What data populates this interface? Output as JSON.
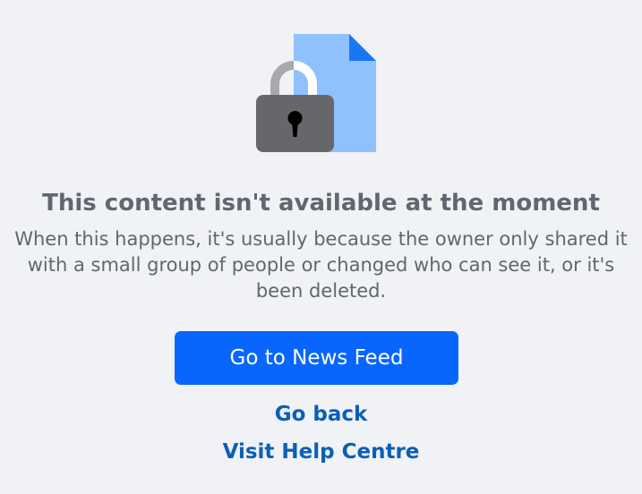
{
  "message": {
    "title": "This content isn't available at the moment",
    "description": "When this happens, it's usually because the owner only shared it with a small group of people or changed who can see it, or it's been deleted."
  },
  "actions": {
    "news_feed_label": "Go to News Feed",
    "go_back_label": "Go back",
    "help_centre_label": "Visit Help Centre"
  },
  "illustration": {
    "icon": "locked-document-icon"
  },
  "colors": {
    "background": "#f0f2f5",
    "primary_button": "#0866ff",
    "link": "#0a5fb8",
    "text": "#606770",
    "document": "#8fc1ff",
    "document_fold": "#1877f2",
    "lock_body": "#66676b",
    "lock_shackle": "#a8a9ad"
  }
}
